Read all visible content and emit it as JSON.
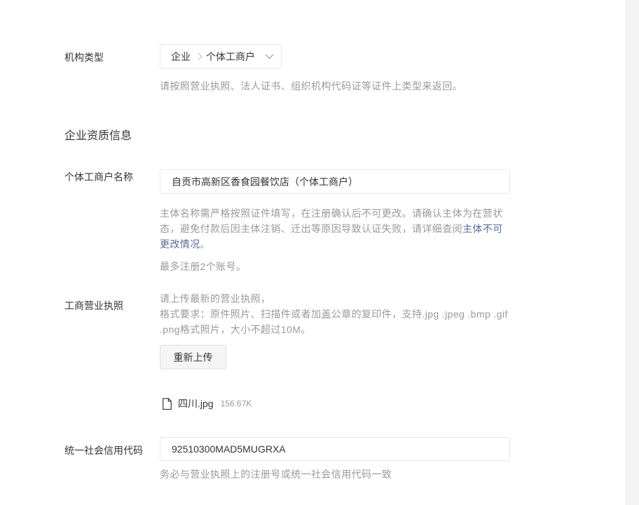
{
  "org_type": {
    "label": "机构类型",
    "selector": {
      "level1": "企业",
      "level2": "个体工商户"
    },
    "hint": "请按照营业执照、法人证书、组织机构代码证等证件上类型来返回。"
  },
  "section_title": "企业资质信息",
  "business_name": {
    "label": "个体工商户名称",
    "value": "自贡市高新区香食园餐饮店（个体工商户）",
    "hint_before_link": "主体名称需严格按照证件填写，在注册确认后不可更改。请确认主体为在营状态，避免付款后因主体注销、迁出等原因导致认证失败，请详细查阅",
    "hint_link": "主体不可更改情况",
    "hint_after_link": "。",
    "account_limit": "最多注册2个账号。"
  },
  "business_license": {
    "label": "工商营业执照",
    "instruction": "请上传最新的营业执照，",
    "format_requirements": "格式要求：原件照片、扫描件或者加盖公章的复印件，支持.jpg .jpeg .bmp .gif .png格式照片，大小不超过10M。",
    "reupload_label": "重新上传",
    "uploaded_file": {
      "icon": "document-icon",
      "name": "四川.jpg",
      "size": "156.67K"
    }
  },
  "credit_code": {
    "label": "统一社会信用代码",
    "value": "92510300MAD5MUGRXA",
    "hint": "务必与营业执照上的注册号或统一社会信用代码一致"
  },
  "icons": {
    "cascade_separator": "chevron-right-icon",
    "dropdown": "chevron-down-icon",
    "file": "document-icon"
  },
  "colors": {
    "text": "#353535",
    "hint": "#9a9a9a",
    "link": "#576b95",
    "border": "#e4e8eb",
    "button_bg": "#f5f5f5",
    "button_border": "#e0e0e0",
    "gutter": "#f3f3f4"
  }
}
